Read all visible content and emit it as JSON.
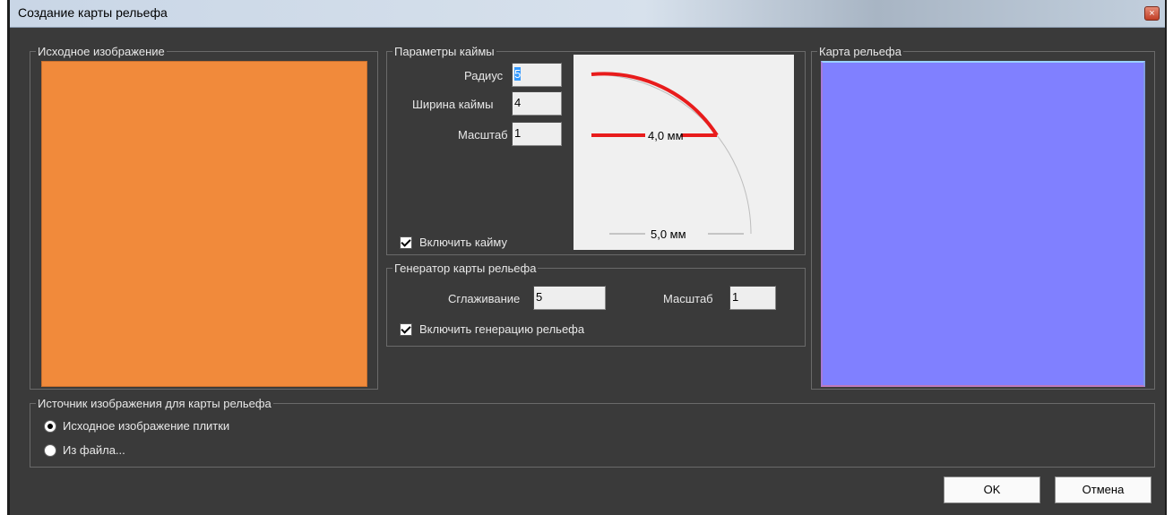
{
  "window": {
    "title": "Создание карты рельефа",
    "close_glyph": "×"
  },
  "source_image": {
    "legend": "Исходное изображение",
    "color": "#f18a3b"
  },
  "border_params": {
    "legend": "Параметры каймы",
    "radius_label": "Радиус",
    "radius_value": "5",
    "width_label": "Ширина каймы",
    "width_value": "4",
    "scale_label": "Масштаб",
    "scale_value": "1",
    "enable_label": "Включить кайму",
    "enable_checked": true,
    "preview": {
      "inner_label": "4,0 мм",
      "outer_label": "5,0 мм",
      "accent": "#e81c1c"
    }
  },
  "generator": {
    "legend": "Генератор карты рельефа",
    "smoothing_label": "Сглаживание",
    "smoothing_value": "5",
    "scale_label": "Масштаб",
    "scale_value": "1",
    "enable_label": "Включить генерацию рельефа",
    "enable_checked": true
  },
  "relief_map": {
    "legend": "Карта рельефа",
    "color": "#8080ff"
  },
  "source": {
    "legend": "Источник изображения для карты рельефа",
    "options": [
      {
        "label": "Исходное изображение плитки",
        "selected": true
      },
      {
        "label": "Из файла...",
        "selected": false
      }
    ]
  },
  "buttons": {
    "ok": "OK",
    "cancel": "Отмена"
  }
}
